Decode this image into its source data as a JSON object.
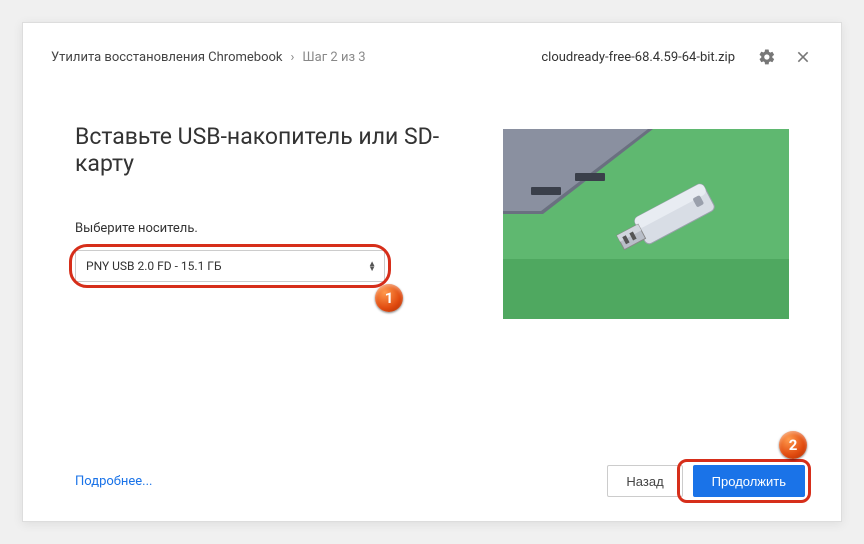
{
  "header": {
    "title": "Утилита восстановления Chromebook",
    "step": "Шаг 2 из 3",
    "filename": "cloudready-free-68.4.59-64-bit.zip"
  },
  "main": {
    "heading": "Вставьте USB-накопитель или SD-карту",
    "select_label": "Выберите носитель.",
    "selected_media": "PNY USB 2.0 FD - 15.1 ГБ"
  },
  "footer": {
    "more": "Подробнее...",
    "back": "Назад",
    "continue": "Продолжить"
  },
  "annotations": {
    "badge1": "1",
    "badge2": "2"
  }
}
